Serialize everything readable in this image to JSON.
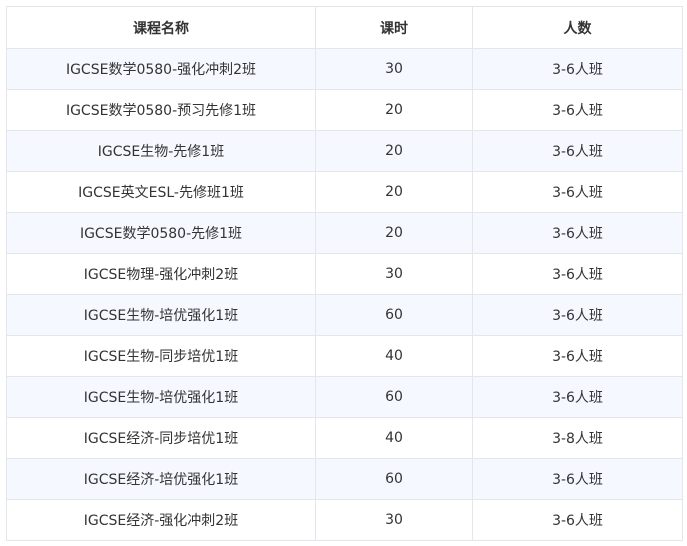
{
  "table": {
    "headers": [
      "课程名称",
      "课时",
      "人数"
    ],
    "rows": [
      [
        "IGCSE数学0580-强化冲刺2班",
        "30",
        "3-6人班"
      ],
      [
        "IGCSE数学0580-预习先修1班",
        "20",
        "3-6人班"
      ],
      [
        "IGCSE生物-先修1班",
        "20",
        "3-6人班"
      ],
      [
        "IGCSE英文ESL-先修班1班",
        "20",
        "3-6人班"
      ],
      [
        "IGCSE数学0580-先修1班",
        "20",
        "3-6人班"
      ],
      [
        "IGCSE物理-强化冲刺2班",
        "30",
        "3-6人班"
      ],
      [
        "IGCSE生物-培优强化1班",
        "60",
        "3-6人班"
      ],
      [
        "IGCSE生物-同步培优1班",
        "40",
        "3-6人班"
      ],
      [
        "IGCSE生物-培优强化1班",
        "60",
        "3-6人班"
      ],
      [
        "IGCSE经济-同步培优1班",
        "40",
        "3-8人班"
      ],
      [
        "IGCSE经济-培优强化1班",
        "60",
        "3-6人班"
      ],
      [
        "IGCSE经济-强化冲刺2班",
        "30",
        "3-6人班"
      ]
    ]
  }
}
